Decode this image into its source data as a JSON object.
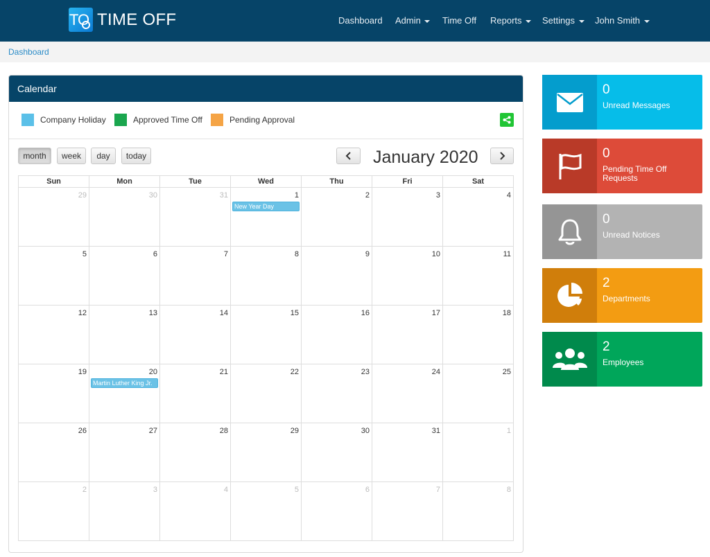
{
  "brand": {
    "logo_text": "TO",
    "name": "TIME OFF"
  },
  "nav": {
    "items": [
      {
        "label": "Dashboard",
        "dropdown": false
      },
      {
        "label": "Admin",
        "dropdown": true
      },
      {
        "label": "Time Off",
        "dropdown": false
      },
      {
        "label": "Reports",
        "dropdown": true
      },
      {
        "label": "Settings",
        "dropdown": true
      },
      {
        "label": "John Smith",
        "dropdown": true
      }
    ]
  },
  "breadcrumb": {
    "current": "Dashboard"
  },
  "calendar": {
    "panel_title": "Calendar",
    "legend": [
      {
        "label": "Company Holiday",
        "color": "#5bc0e8"
      },
      {
        "label": "Approved Time Off",
        "color": "#1aa64e"
      },
      {
        "label": "Pending Approval",
        "color": "#f5a445"
      }
    ],
    "views": {
      "month": "month",
      "week": "week",
      "day": "day",
      "today": "today",
      "active": "month"
    },
    "month_title": "January 2020",
    "prev_icon": "chevron-left-icon",
    "next_icon": "chevron-right-icon",
    "weekdays": [
      "Sun",
      "Mon",
      "Tue",
      "Wed",
      "Thu",
      "Fri",
      "Sat"
    ],
    "weeks": [
      [
        {
          "d": "29",
          "o": true
        },
        {
          "d": "30",
          "o": true
        },
        {
          "d": "31",
          "o": true
        },
        {
          "d": "1",
          "o": false,
          "event": "New Year Day"
        },
        {
          "d": "2",
          "o": false
        },
        {
          "d": "3",
          "o": false
        },
        {
          "d": "4",
          "o": false
        }
      ],
      [
        {
          "d": "5",
          "o": false
        },
        {
          "d": "6",
          "o": false
        },
        {
          "d": "7",
          "o": false
        },
        {
          "d": "8",
          "o": false
        },
        {
          "d": "9",
          "o": false
        },
        {
          "d": "10",
          "o": false
        },
        {
          "d": "11",
          "o": false
        }
      ],
      [
        {
          "d": "12",
          "o": false
        },
        {
          "d": "13",
          "o": false
        },
        {
          "d": "14",
          "o": false
        },
        {
          "d": "15",
          "o": false
        },
        {
          "d": "16",
          "o": false
        },
        {
          "d": "17",
          "o": false
        },
        {
          "d": "18",
          "o": false
        }
      ],
      [
        {
          "d": "19",
          "o": false
        },
        {
          "d": "20",
          "o": false,
          "event": "Martin Luther King Jr."
        },
        {
          "d": "21",
          "o": false
        },
        {
          "d": "22",
          "o": false
        },
        {
          "d": "23",
          "o": false
        },
        {
          "d": "24",
          "o": false
        },
        {
          "d": "25",
          "o": false
        }
      ],
      [
        {
          "d": "26",
          "o": false
        },
        {
          "d": "27",
          "o": false
        },
        {
          "d": "28",
          "o": false
        },
        {
          "d": "29",
          "o": false
        },
        {
          "d": "30",
          "o": false
        },
        {
          "d": "31",
          "o": false
        },
        {
          "d": "1",
          "o": true
        }
      ],
      [
        {
          "d": "2",
          "o": true
        },
        {
          "d": "3",
          "o": true
        },
        {
          "d": "4",
          "o": true
        },
        {
          "d": "5",
          "o": true
        },
        {
          "d": "6",
          "o": true
        },
        {
          "d": "7",
          "o": true
        },
        {
          "d": "8",
          "o": true
        }
      ]
    ]
  },
  "tiles": [
    {
      "count": "0",
      "label": "Unread Messages",
      "icon": "envelope-icon",
      "icon_bg": "#049dcd",
      "bg": "#06bde9"
    },
    {
      "count": "0",
      "label": "Pending Time Off Requests",
      "icon": "flag-icon",
      "icon_bg": "#b93a28",
      "bg": "#dd4b39"
    },
    {
      "count": "0",
      "label": "Unread Notices",
      "icon": "bell-icon",
      "icon_bg": "#959595",
      "bg": "#b3b3b3"
    },
    {
      "count": "2",
      "label": "Departments",
      "icon": "pie-chart-icon",
      "icon_bg": "#d07e0b",
      "bg": "#f39c12"
    },
    {
      "count": "2",
      "label": "Employees",
      "icon": "users-icon",
      "icon_bg": "#008a4c",
      "bg": "#00a65a"
    }
  ]
}
